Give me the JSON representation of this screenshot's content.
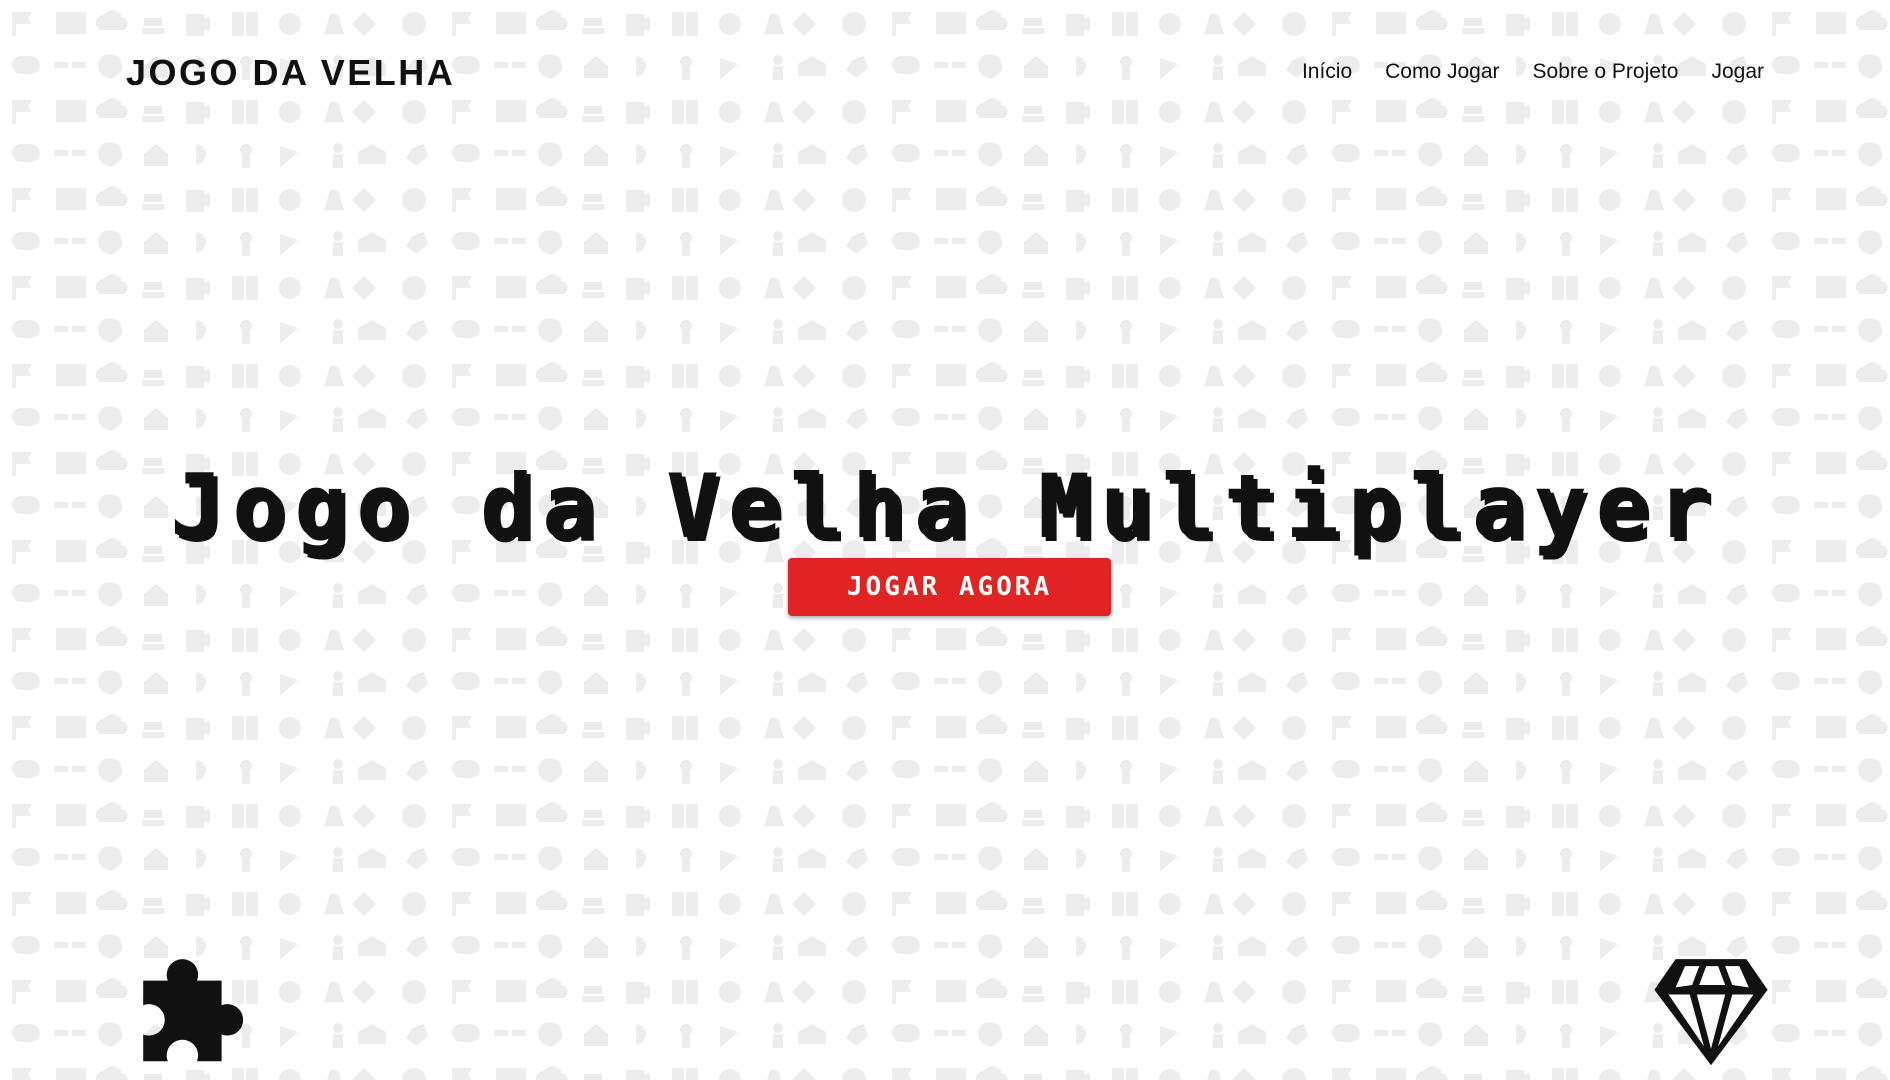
{
  "header": {
    "brand": "JOGO DA VELHA",
    "nav": [
      {
        "label": "Início"
      },
      {
        "label": "Como Jogar"
      },
      {
        "label": "Sobre o Projeto"
      },
      {
        "label": "Jogar"
      }
    ]
  },
  "hero": {
    "title": "Jogo da Velha Multiplayer",
    "cta_label": "JOGAR AGORA"
  },
  "decor": {
    "left_icon": "puzzle-piece-icon",
    "right_icon": "diamond-icon",
    "background": "gray-icon-pattern"
  },
  "colors": {
    "accent": "#e02424",
    "text": "#111111",
    "pattern": "#ececec"
  }
}
